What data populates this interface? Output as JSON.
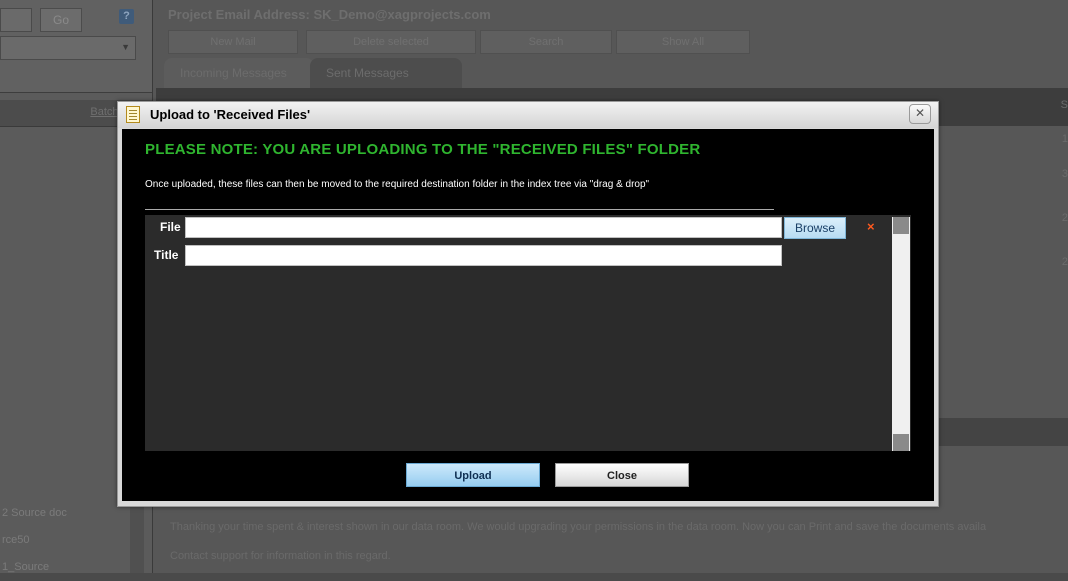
{
  "background": {
    "go_label": "Go",
    "help_icon": "?",
    "batch_link": "Batch Func",
    "project_email": "Project Email Address: SK_Demo@xagprojects.com",
    "toolbar": [
      "New Mail",
      "Delete selected",
      "Search",
      "Show All"
    ],
    "tabs": [
      "Incoming Messages",
      "Sent Messages"
    ],
    "right_numbers": [
      "S",
      "1",
      "3",
      "2",
      "2"
    ],
    "tree_items": [
      "2 Source doc",
      "rce50",
      "1_Source"
    ],
    "footer_line1": "Thanking your time spent & interest shown in our data room. We would upgrading your permissions in the data room. Now you can Print and save the documents availa",
    "footer_line2": "Contact support for information in this regard."
  },
  "modal": {
    "title": "Upload to 'Received Files'",
    "close_glyph": "✕",
    "note": "PLEASE NOTE: YOU ARE UPLOADING TO THE \"RECEIVED FILES\" FOLDER",
    "subnote": "Once uploaded, these files can then be moved to the required destination folder in the index tree via \"drag & drop\"",
    "file_label": "File",
    "title_label": "Title",
    "file_value": "",
    "title_value": "",
    "browse_label": "Browse",
    "remove_glyph": "×",
    "upload_label": "Upload",
    "close_label": "Close",
    "colors": {
      "note_green": "#2fb52f",
      "remove_orange": "#ff5a1f",
      "upload_blue": "#96cdf0"
    }
  }
}
